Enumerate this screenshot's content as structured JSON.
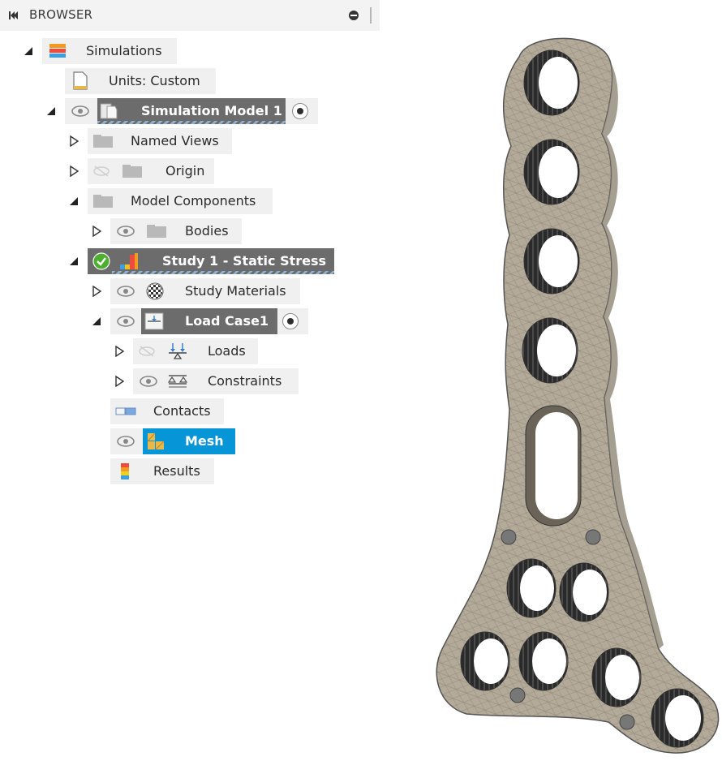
{
  "browser": {
    "title": "BROWSER"
  },
  "tree": {
    "simulations": "Simulations",
    "units": "Units: Custom",
    "simulation_model": "Simulation Model 1",
    "named_views": "Named Views",
    "origin": "Origin",
    "model_components": "Model Components",
    "bodies": "Bodies",
    "study": "Study 1 - Static Stress",
    "study_materials": "Study Materials",
    "load_case": "Load Case1",
    "loads": "Loads",
    "constraints": "Constraints",
    "contacts": "Contacts",
    "mesh": "Mesh",
    "results": "Results"
  },
  "icons": {
    "header": [
      "collapse-left-icon",
      "pin-icon"
    ],
    "tree": [
      "triangle-expanded-icon",
      "triangle-collapsed-icon",
      "eye-icon",
      "eye-hidden-icon",
      "folder-icon",
      "simulations-icon",
      "units-icon",
      "model-icon",
      "study-icon",
      "materials-icon",
      "load-case-icon",
      "loads-icon",
      "constraints-icon",
      "contacts-icon",
      "mesh-icon",
      "results-icon",
      "check-icon",
      "activate-radio-icon"
    ]
  },
  "colors": {
    "selected_dark": "#6c6c6c",
    "selected_blue": "#0696d7",
    "row_bg": "#f0f0f0",
    "model_fill": "#b3aa99"
  }
}
